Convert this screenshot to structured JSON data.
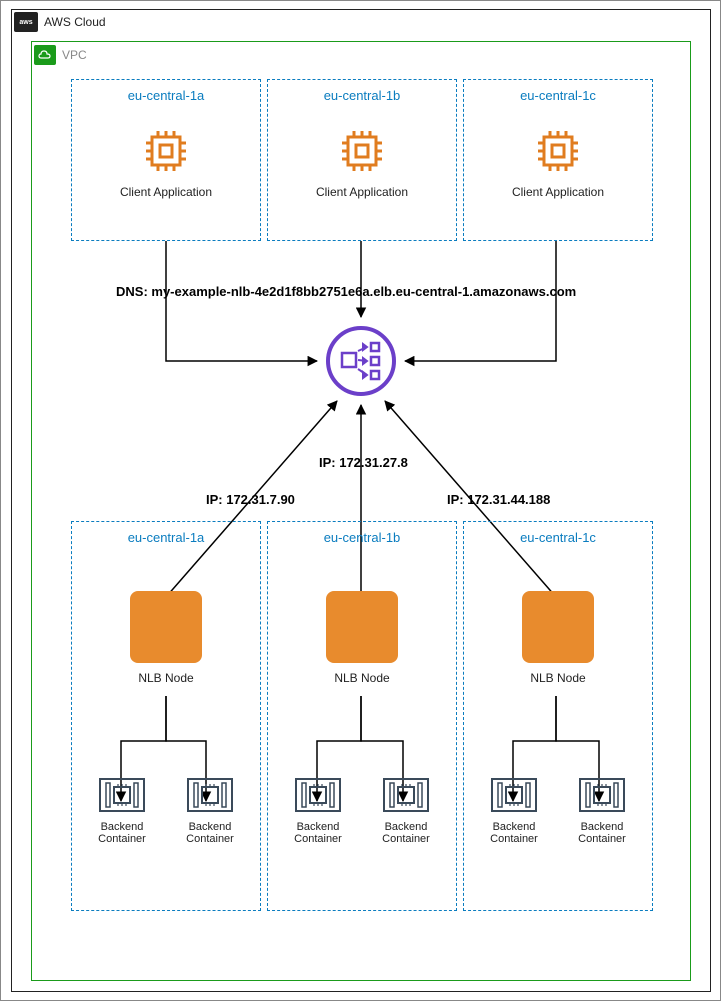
{
  "cloud_label": "AWS Cloud",
  "vpc_label": "VPC",
  "zones_top": [
    {
      "title": "eu-central-1a",
      "label": "Client Application"
    },
    {
      "title": "eu-central-1b",
      "label": "Client Application"
    },
    {
      "title": "eu-central-1c",
      "label": "Client Application"
    }
  ],
  "dns_line": "DNS: my-example-nlb-4e2d1f8bb2751e6a.elb.eu-central-1.amazonaws.com",
  "ip_labels": {
    "a": "IP: 172.31.7.90",
    "b": "IP: 172.31.27.8",
    "c": "IP: 172.31.44.188"
  },
  "zones_bottom": [
    {
      "title": "eu-central-1a",
      "node_label": "NLB Node",
      "backends": [
        {
          "label": "Backend\nContainer"
        },
        {
          "label": "Backend\nContainer"
        }
      ]
    },
    {
      "title": "eu-central-1b",
      "node_label": "NLB Node",
      "backends": [
        {
          "label": "Backend\nContainer"
        },
        {
          "label": "Backend\nContainer"
        }
      ]
    },
    {
      "title": "eu-central-1c",
      "node_label": "NLB Node",
      "backends": [
        {
          "label": "Backend\nContainer"
        },
        {
          "label": "Backend\nContainer"
        }
      ]
    }
  ]
}
